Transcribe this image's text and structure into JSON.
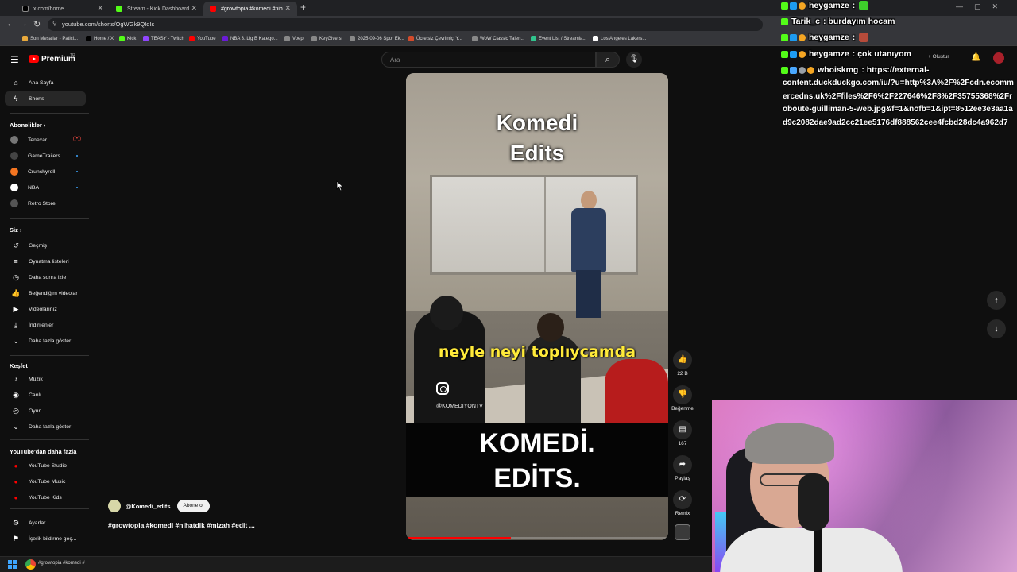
{
  "browser": {
    "tabs": [
      {
        "label": "x.com/home",
        "color": "#000000"
      },
      {
        "label": "Stream - Kick Dashboard",
        "color": "#53fc18"
      },
      {
        "label": "#growtopia #komedi #nihat",
        "color": "#ff0000"
      }
    ],
    "url": "youtube.com/shorts/OgWGk9QIqIs",
    "bookmarks": [
      {
        "label": "Son Mesajlar - Patici...",
        "color": "#e8a93c"
      },
      {
        "label": "Home / X",
        "color": "#000000"
      },
      {
        "label": "Kick",
        "color": "#53fc18"
      },
      {
        "label": "TEASY - Twitch",
        "color": "#9146ff"
      },
      {
        "label": "YouTube",
        "color": "#ff0000"
      },
      {
        "label": "NBA 3. Lig B Katego...",
        "color": "#6a1bd6"
      },
      {
        "label": "Voep",
        "color": "#888888"
      },
      {
        "label": "KeyGivers",
        "color": "#888888"
      },
      {
        "label": "2025-09-06 Spor Ek...",
        "color": "#888888"
      },
      {
        "label": "Ücretsiz Çevrimiçi Y...",
        "color": "#d34b2b"
      },
      {
        "label": "WoW Classic Talen...",
        "color": "#888888"
      },
      {
        "label": "Event List / Streamla...",
        "color": "#31c48d"
      },
      {
        "label": "Los Angeles Lakers...",
        "color": "#ffffff"
      }
    ]
  },
  "youtube": {
    "brand": "Premium",
    "brand_sup": "TR",
    "search_placeholder": "Ara",
    "create_label": "Oluştur",
    "sidebar": {
      "top": [
        {
          "label": "Ana Sayfa",
          "icon": "home-icon",
          "glyph": "⌂"
        },
        {
          "label": "Shorts",
          "icon": "shorts-icon",
          "glyph": "ϟ"
        }
      ],
      "subs_heading": "Abonelikler",
      "channels": [
        {
          "label": "Tenexar",
          "color": "#777777",
          "live": true
        },
        {
          "label": "GameTrailers",
          "color": "#444444",
          "dot": true
        },
        {
          "label": "Crunchyroll",
          "color": "#f47521",
          "dot": true
        },
        {
          "label": "NBA",
          "color": "#ffffff",
          "dot": true
        },
        {
          "label": "Retro Store",
          "color": "#555555"
        }
      ],
      "you_heading": "Siz",
      "you_items": [
        {
          "label": "Geçmiş",
          "glyph": "↺"
        },
        {
          "label": "Oynatma listeleri",
          "glyph": "≡"
        },
        {
          "label": "Daha sonra izle",
          "glyph": "◷"
        },
        {
          "label": "Beğendiğim videolar",
          "glyph": "👍"
        },
        {
          "label": "Videolarınız",
          "glyph": "▶"
        },
        {
          "label": "İndirilenler",
          "glyph": "⤓"
        },
        {
          "label": "Daha fazla göster",
          "glyph": "⌄"
        }
      ],
      "explore_heading": "Keşfet",
      "explore_items": [
        {
          "label": "Müzik",
          "glyph": "♪"
        },
        {
          "label": "Canlı",
          "glyph": "◉"
        },
        {
          "label": "Oyun",
          "glyph": "◎"
        },
        {
          "label": "Daha fazla göster",
          "glyph": "⌄"
        }
      ],
      "more_heading": "YouTube'dan daha fazla",
      "more_items": [
        {
          "label": "YouTube Studio"
        },
        {
          "label": "YouTube Music"
        },
        {
          "label": "YouTube Kids"
        }
      ],
      "bottom_items": [
        {
          "label": "Ayarlar",
          "glyph": "⚙"
        },
        {
          "label": "İçerik bildirme geç...",
          "glyph": "⚑"
        }
      ]
    },
    "short": {
      "title": "Komedi\nEdits",
      "subtitle": "neyle neyi toplıycamda",
      "handle": "@KOMEDIYONTV",
      "big_text": "KOMEDİ.\nEDİTS.",
      "progress": 0.4
    },
    "actions": {
      "likes": "22 B",
      "dislike": "Beğenme",
      "comments": "167",
      "share": "Paylaş",
      "remix": "Remix"
    },
    "channel": {
      "name": "@Komedi_edits",
      "subscribe": "Abone ol",
      "caption": "#growtopia #komedi #nihatdik #mizah #edit ..."
    }
  },
  "chat": {
    "lines": [
      {
        "user": "heygamze",
        "msg": ":",
        "emote": "#3ecf2b"
      },
      {
        "user": "Tarik_c",
        "msg": ": burdayım hocam"
      },
      {
        "user": "heygamze",
        "msg": ":",
        "emote": "#b64b3a"
      },
      {
        "user": "heygamze",
        "msg": ": çok utanıyom"
      },
      {
        "user": "whoiskmg",
        "msg": ": https://external-"
      }
    ],
    "long_text": "content.duckduckgo.com/iu/?u=http%3A%2F%2Fcdn.ecommercedns.uk%2Ffiles%2F6%2F227646%2F8%2F35755368%2Froboute-guilliman-5-web.jpg&f=1&nofb=1&ipt=8512ee3e3aa1ad9c2082dae9ad2cc21ee5176df888562cee4fcbd28dc4a962d7"
  },
  "taskbar": {
    "title": "#growtopia #komedi #"
  }
}
